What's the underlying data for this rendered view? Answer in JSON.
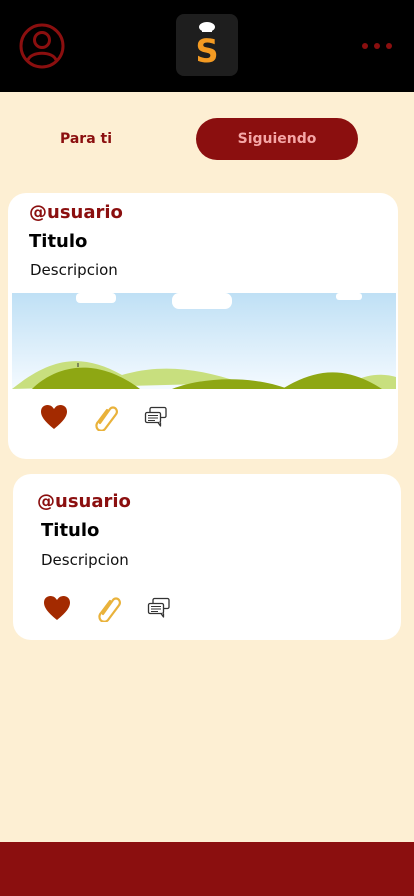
{
  "header": {
    "profile_icon": "user-circle-icon",
    "logo_icon": "chef-s-logo",
    "logo_letter": "S",
    "menu_icon": "more-dots-icon"
  },
  "tabs": [
    {
      "label": "Para ti",
      "active": false
    },
    {
      "label": "Siguiendo",
      "active": true
    }
  ],
  "posts": [
    {
      "handle": "@usuario",
      "title": "Titulo",
      "description": "Descripcion",
      "has_image": true
    },
    {
      "handle": "@usuario",
      "title": "Titulo",
      "description": "Descripcion",
      "has_image": false
    }
  ],
  "colors": {
    "primary": "#8b0f0f",
    "background": "#fdefd3",
    "topbar": "#000000",
    "like": "#a32a00",
    "clip": "#e9b23b"
  }
}
